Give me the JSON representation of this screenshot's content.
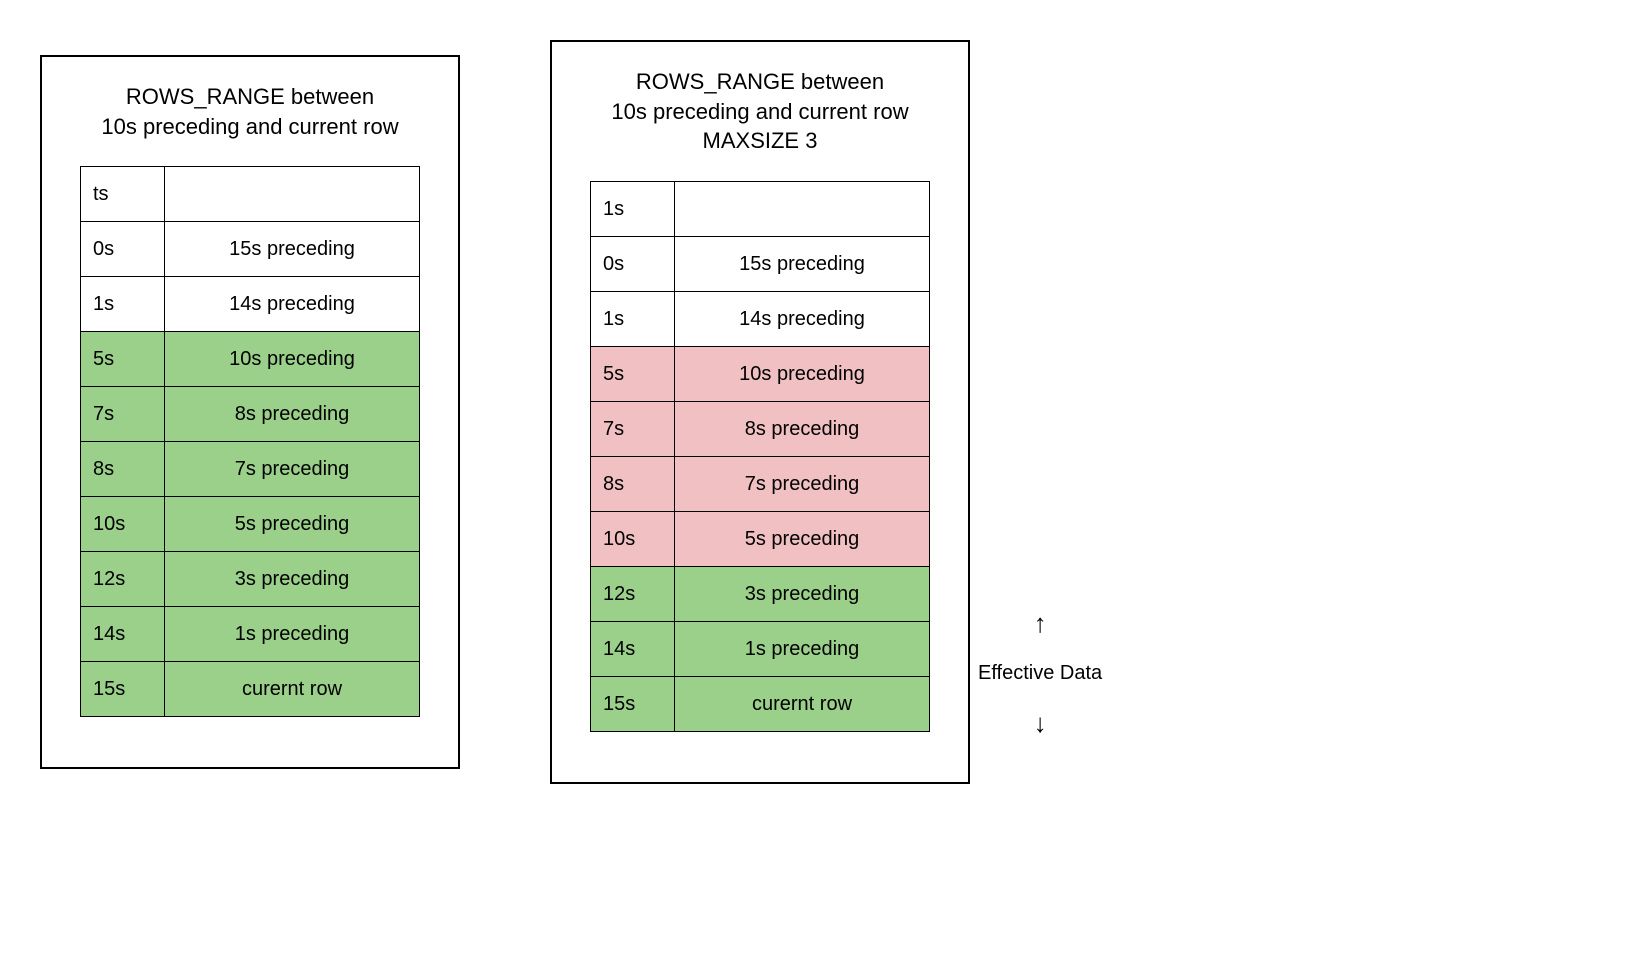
{
  "left": {
    "title": "ROWS_RANGE between\n10s preceding and current row",
    "rows": [
      {
        "ts": "ts",
        "desc": "",
        "fill": "white"
      },
      {
        "ts": "0s",
        "desc": "15s preceding",
        "fill": "white"
      },
      {
        "ts": "1s",
        "desc": "14s preceding",
        "fill": "white"
      },
      {
        "ts": "5s",
        "desc": "10s preceding",
        "fill": "green"
      },
      {
        "ts": "7s",
        "desc": "8s preceding",
        "fill": "green"
      },
      {
        "ts": "8s",
        "desc": "7s preceding",
        "fill": "green"
      },
      {
        "ts": "10s",
        "desc": "5s preceding",
        "fill": "green"
      },
      {
        "ts": "12s",
        "desc": "3s preceding",
        "fill": "green"
      },
      {
        "ts": "14s",
        "desc": "1s preceding",
        "fill": "green"
      },
      {
        "ts": "15s",
        "desc": "curernt row",
        "fill": "green"
      }
    ]
  },
  "right": {
    "title": "ROWS_RANGE between\n10s preceding and current row\nMAXSIZE 3",
    "rows": [
      {
        "ts": "1s",
        "desc": "",
        "fill": "white"
      },
      {
        "ts": "0s",
        "desc": "15s preceding",
        "fill": "white"
      },
      {
        "ts": "1s",
        "desc": "14s preceding",
        "fill": "white"
      },
      {
        "ts": "5s",
        "desc": "10s preceding",
        "fill": "pink"
      },
      {
        "ts": "7s",
        "desc": "8s preceding",
        "fill": "pink"
      },
      {
        "ts": "8s",
        "desc": "7s preceding",
        "fill": "pink"
      },
      {
        "ts": "10s",
        "desc": "5s preceding",
        "fill": "pink"
      },
      {
        "ts": "12s",
        "desc": "3s preceding",
        "fill": "green"
      },
      {
        "ts": "14s",
        "desc": "1s preceding",
        "fill": "green"
      },
      {
        "ts": "15s",
        "desc": "curernt row",
        "fill": "green"
      }
    ],
    "annotation": "Effective Data"
  }
}
